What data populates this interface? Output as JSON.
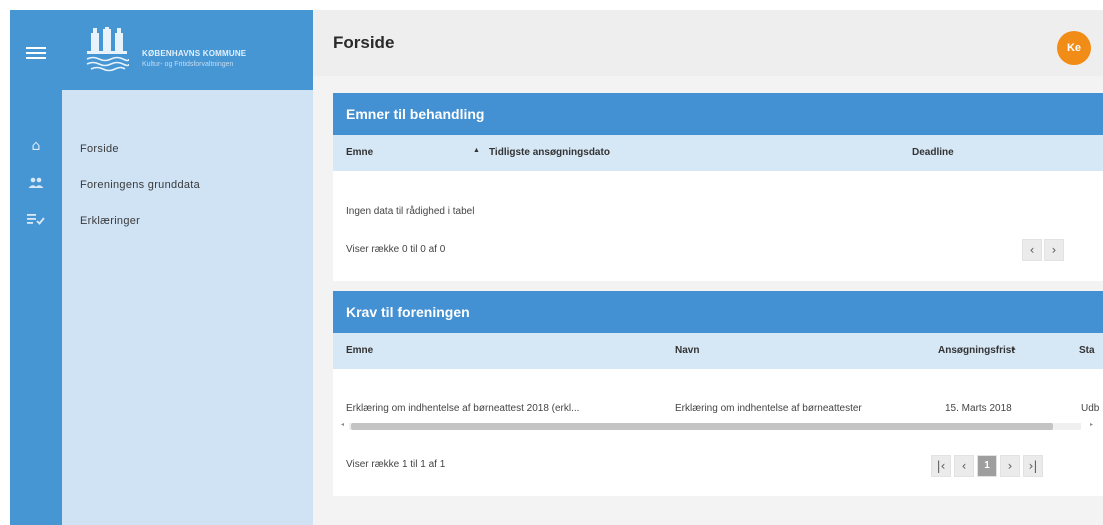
{
  "brand": {
    "name": "KØBENHAVNS KOMMUNE",
    "subtitle": "Kultur- og Fritidsforvaltningen"
  },
  "rail": {
    "menu_icon": "hamburger-icon",
    "items": [
      {
        "icon": "home-icon"
      },
      {
        "icon": "people-icon"
      },
      {
        "icon": "checklist-icon"
      }
    ]
  },
  "sidebar": {
    "items": [
      {
        "label": "Forside"
      },
      {
        "label": "Foreningens grunddata"
      },
      {
        "label": "Erklæringer"
      }
    ]
  },
  "header": {
    "title": "Forside",
    "avatar_initials": "Ke"
  },
  "emner": {
    "title": "Emner til behandling",
    "columns": [
      "Emne",
      "Tidligste ansøgningsdato",
      "Deadline"
    ],
    "empty_text": "Ingen data til rådighed i tabel",
    "footer": "Viser række 0 til 0 af 0"
  },
  "krav": {
    "title": "Krav til foreningen",
    "columns": [
      "Emne",
      "Navn",
      "Ansøgningsfrist",
      "Sta"
    ],
    "rows": [
      {
        "emne": "Erklæring om indhentelse af børneattest 2018 (erkl...",
        "navn": "Erklæring om indhentelse af børneattester",
        "frist": "15. Marts 2018",
        "status": "Udb"
      }
    ],
    "footer": "Viser række 1 til 1 af 1",
    "current_page": "1"
  },
  "colors": {
    "header_blue": "#4390d2",
    "sidebar": "#cfe3f5",
    "avatar": "#f18c16"
  }
}
